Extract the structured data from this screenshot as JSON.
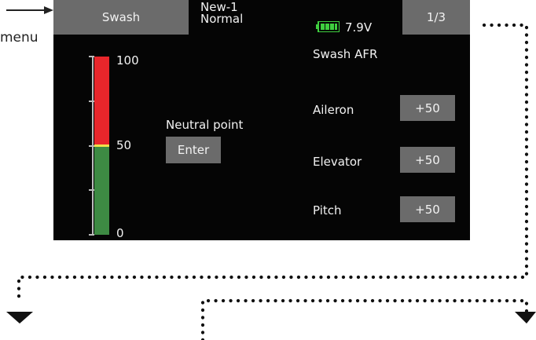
{
  "annotation": {
    "menu_text": "menu"
  },
  "header": {
    "tab_swash": "Swash",
    "model_name": "New-1",
    "condition": "Normal",
    "voltage": "7.9V",
    "page": "1/3"
  },
  "gauge": {
    "label_top": "100",
    "label_mid": "50",
    "label_bottom": "0",
    "neutral_value": 50
  },
  "neutral": {
    "label": "Neutral point",
    "button": "Enter"
  },
  "afr": {
    "title": "Swash AFR",
    "rows": [
      {
        "label": "Aileron",
        "value": "+50"
      },
      {
        "label": "Elevator",
        "value": "+50"
      },
      {
        "label": "Pitch",
        "value": "+50"
      }
    ]
  },
  "colors": {
    "bar_red": "#e8262b",
    "bar_green": "#3d8a43",
    "neutral_line": "#f0e24a",
    "marker": "#e8262b",
    "button": "#6b6b6b"
  },
  "icons": {
    "battery": "battery-icon",
    "arrow": "right-arrow-icon",
    "marker": "triangle-right-icon"
  }
}
